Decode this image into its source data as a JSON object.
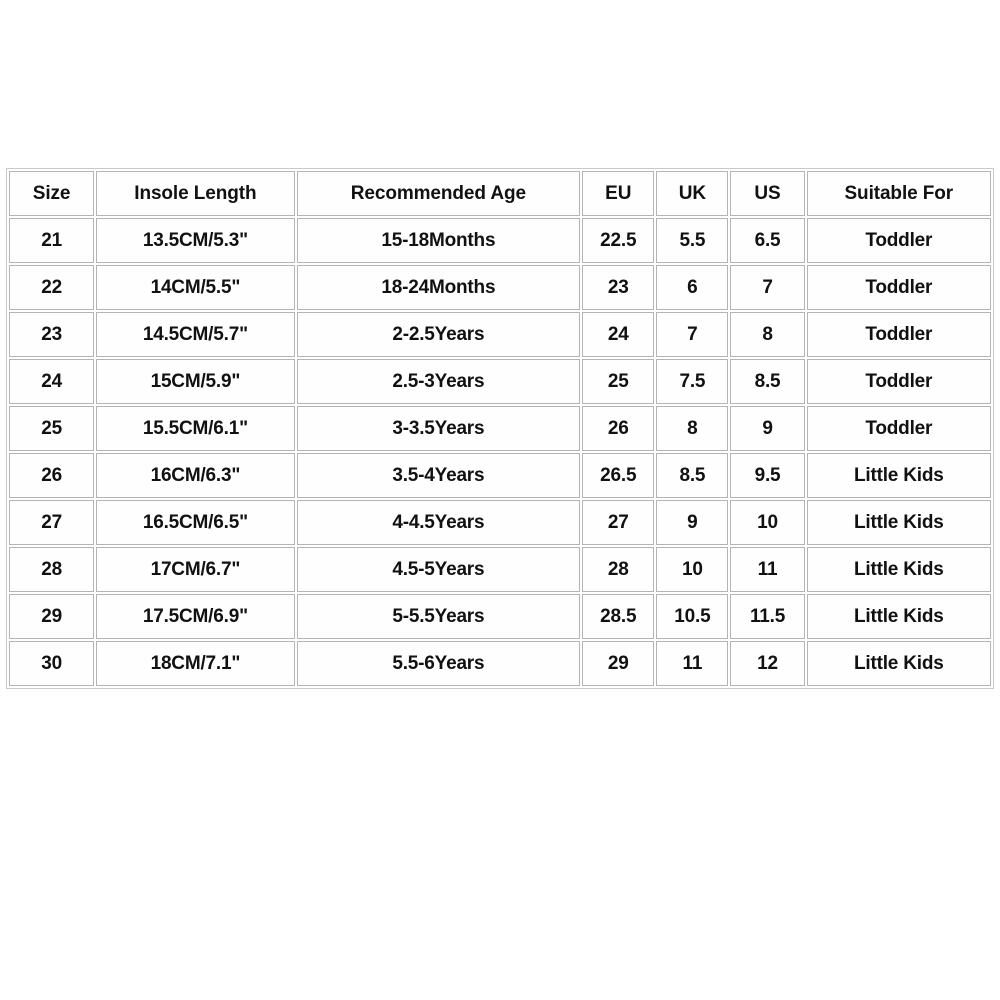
{
  "document": {
    "kind": "children-shoe-size-chart",
    "background_color": "#ffffff",
    "border_color": "#b4b4b4"
  },
  "table": {
    "columns": [
      {
        "key": "size",
        "label": "Size"
      },
      {
        "key": "insole",
        "label": "Insole Length"
      },
      {
        "key": "age",
        "label": "Recommended Age"
      },
      {
        "key": "eu",
        "label": "EU"
      },
      {
        "key": "uk",
        "label": "UK"
      },
      {
        "key": "us",
        "label": "US"
      },
      {
        "key": "suit",
        "label": "Suitable For"
      }
    ],
    "rows": [
      {
        "size": "21",
        "insole": "13.5CM/5.3\"",
        "age": "15-18Months",
        "eu": "22.5",
        "uk": "5.5",
        "us": "6.5",
        "suit": "Toddler"
      },
      {
        "size": "22",
        "insole": "14CM/5.5\"",
        "age": "18-24Months",
        "eu": "23",
        "uk": "6",
        "us": "7",
        "suit": "Toddler"
      },
      {
        "size": "23",
        "insole": "14.5CM/5.7\"",
        "age": "2-2.5Years",
        "eu": "24",
        "uk": "7",
        "us": "8",
        "suit": "Toddler"
      },
      {
        "size": "24",
        "insole": "15CM/5.9\"",
        "age": "2.5-3Years",
        "eu": "25",
        "uk": "7.5",
        "us": "8.5",
        "suit": "Toddler"
      },
      {
        "size": "25",
        "insole": "15.5CM/6.1\"",
        "age": "3-3.5Years",
        "eu": "26",
        "uk": "8",
        "us": "9",
        "suit": "Toddler"
      },
      {
        "size": "26",
        "insole": "16CM/6.3\"",
        "age": "3.5-4Years",
        "eu": "26.5",
        "uk": "8.5",
        "us": "9.5",
        "suit": "Little Kids"
      },
      {
        "size": "27",
        "insole": "16.5CM/6.5\"",
        "age": "4-4.5Years",
        "eu": "27",
        "uk": "9",
        "us": "10",
        "suit": "Little Kids"
      },
      {
        "size": "28",
        "insole": "17CM/6.7\"",
        "age": "4.5-5Years",
        "eu": "28",
        "uk": "10",
        "us": "11",
        "suit": "Little Kids"
      },
      {
        "size": "29",
        "insole": "17.5CM/6.9\"",
        "age": "5-5.5Years",
        "eu": "28.5",
        "uk": "10.5",
        "us": "11.5",
        "suit": "Little Kids"
      },
      {
        "size": "30",
        "insole": "18CM/7.1\"",
        "age": "5.5-6Years",
        "eu": "29",
        "uk": "11",
        "us": "12",
        "suit": "Little Kids"
      }
    ]
  }
}
